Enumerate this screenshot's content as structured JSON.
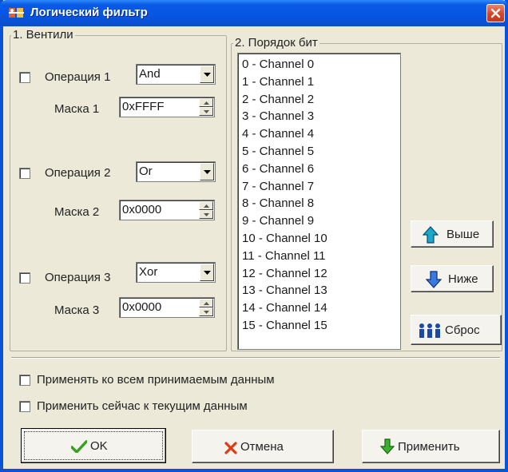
{
  "window": {
    "title": "Логический фильтр"
  },
  "gates": {
    "group_label": "1. Вентили",
    "rows": [
      {
        "op_label": "Операция 1",
        "op_value": "And",
        "mask_label": "Маска 1",
        "mask_value": "0xFFFF"
      },
      {
        "op_label": "Операция 2",
        "op_value": "Or",
        "mask_label": "Маска 2",
        "mask_value": "0x0000"
      },
      {
        "op_label": "Операция 3",
        "op_value": "Xor",
        "mask_label": "Маска 3",
        "mask_value": "0x0000"
      }
    ]
  },
  "bit_order": {
    "group_label": "2. Порядок бит",
    "items": [
      "0 - Channel 0",
      "1 - Channel 1",
      "2 - Channel 2",
      "3 - Channel 3",
      "4 - Channel 4",
      "5 - Channel 5",
      "6 - Channel 6",
      "7 - Channel 7",
      "8 - Channel 8",
      "9 - Channel 9",
      "10 - Channel 10",
      "11 - Channel 11",
      "12 - Channel 12",
      "13 - Channel 13",
      "14 - Channel 14",
      "15 - Channel 15"
    ],
    "up_label": "Выше",
    "down_label": "Ниже",
    "reset_label": "Сброс"
  },
  "options": {
    "apply_all": "Применять ко всем принимаемым данным",
    "apply_now": "Применить сейчас к текущим данным"
  },
  "buttons": {
    "ok": "OK",
    "cancel": "Отмена",
    "apply": "Применить"
  },
  "colors": {
    "titlebar": "#0854e3",
    "close": "#d2452a",
    "face": "#ece9d8"
  }
}
